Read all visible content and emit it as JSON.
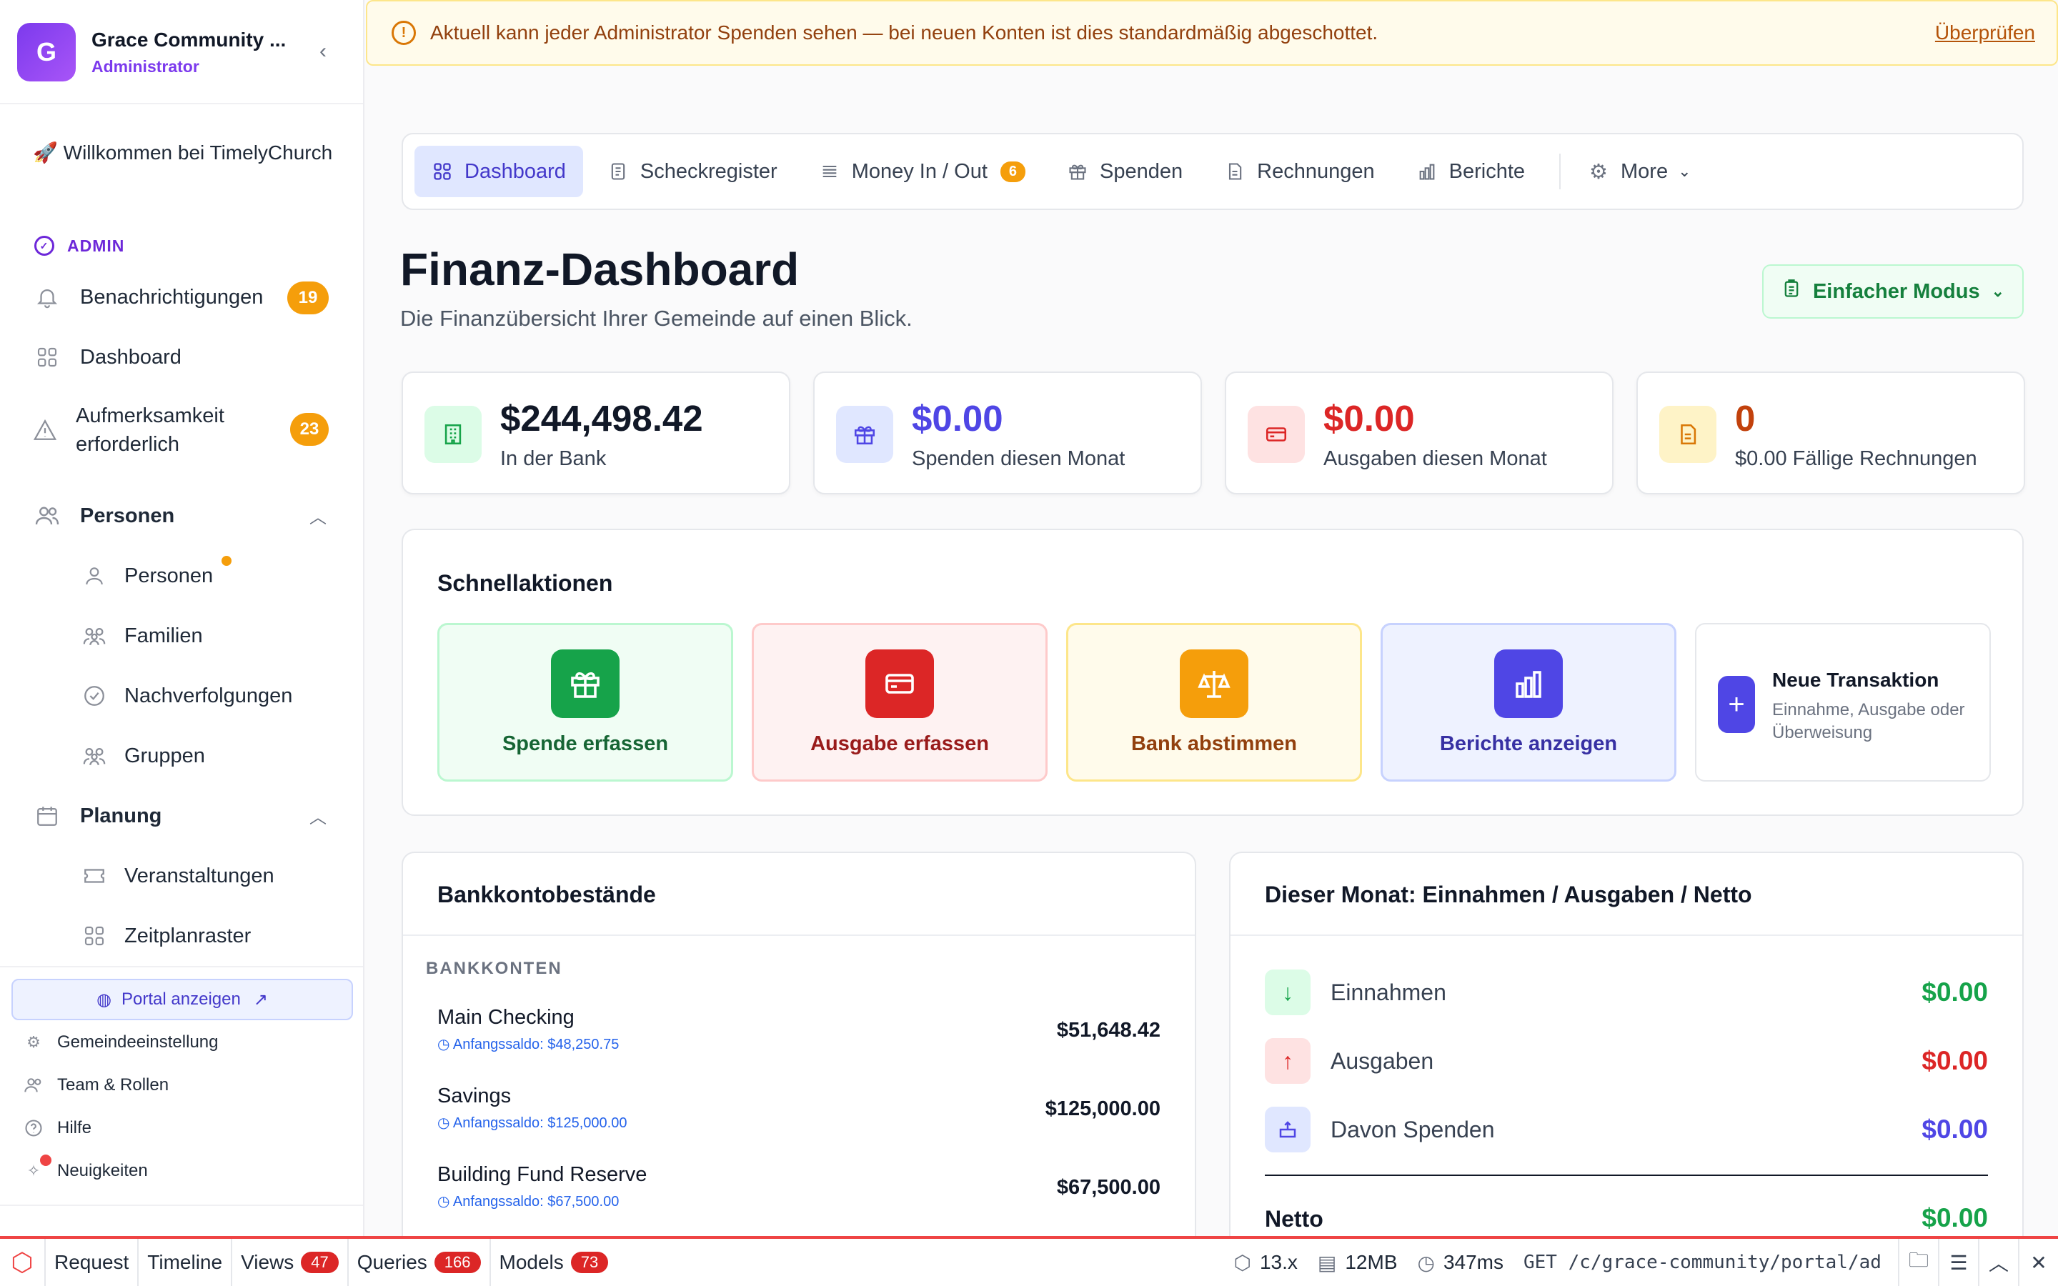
{
  "org": {
    "initial": "G",
    "name": "Grace Community ...",
    "role": "Administrator"
  },
  "sidebar": {
    "welcome": "🚀 Willkommen bei TimelyChurch",
    "admin_label": "ADMIN",
    "notifications": {
      "label": "Benachrichtigungen",
      "count": "19"
    },
    "dashboard": "Dashboard",
    "attention": {
      "label": "Aufmerksamkeit erforderlich",
      "count": "23"
    },
    "people_section": "Personen",
    "people_items": [
      "Personen",
      "Familien",
      "Nachverfolgungen",
      "Gruppen"
    ],
    "planning_section": "Planung",
    "planning_items": [
      "Veranstaltungen",
      "Zeitplanraster"
    ],
    "portal": "Portal anzeigen",
    "footer": [
      "Gemeindeeinstellung",
      "Team & Rollen",
      "Hilfe",
      "Neuigkeiten"
    ]
  },
  "alert": {
    "text": "Aktuell kann jeder Administrator Spenden sehen — bei neuen Konten ist dies standardmäßig abgeschottet.",
    "link": "Überprüfen"
  },
  "tabs": [
    {
      "label": "Dashboard",
      "icon": "grid-icon"
    },
    {
      "label": "Scheckregister",
      "icon": "receipt-icon"
    },
    {
      "label": "Money In / Out",
      "icon": "list-icon",
      "count": "6"
    },
    {
      "label": "Spenden",
      "icon": "gift-icon"
    },
    {
      "label": "Rechnungen",
      "icon": "document-icon"
    },
    {
      "label": "Berichte",
      "icon": "bar-chart-icon"
    },
    {
      "label": "More",
      "icon": "gear-icon"
    }
  ],
  "page": {
    "title": "Finanz-Dashboard",
    "subtitle": "Die Finanzübersicht Ihrer Gemeinde auf einen Blick.",
    "mode_button": "Einfacher Modus"
  },
  "stats": [
    {
      "value": "$244,498.42",
      "label": "In der Bank",
      "color": "#111827",
      "icon": "building-icon"
    },
    {
      "value": "$0.00",
      "label": "Spenden diesen Monat",
      "color": "#4f46e5",
      "icon": "gift-icon"
    },
    {
      "value": "$0.00",
      "label": "Ausgaben diesen Monat",
      "color": "#dc2626",
      "icon": "credit-card-icon"
    },
    {
      "value": "0",
      "label": "$0.00 Fällige Rechnungen",
      "color": "#c2410c",
      "icon": "document-icon"
    }
  ],
  "quick_actions": {
    "title": "Schnellaktionen",
    "items": [
      {
        "label": "Spende erfassen",
        "icon": "gift-icon"
      },
      {
        "label": "Ausgabe erfassen",
        "icon": "credit-card-icon"
      },
      {
        "label": "Bank abstimmen",
        "icon": "scale-icon"
      },
      {
        "label": "Berichte anzeigen",
        "icon": "bar-chart-icon"
      }
    ],
    "new_transaction": {
      "title": "Neue Transaktion",
      "description": "Einnahme, Ausgabe oder Überweisung"
    }
  },
  "bank": {
    "title": "Bankkontobestände",
    "section": "BANKKONTEN",
    "accounts": [
      {
        "name": "Main Checking",
        "opening": "Anfangssaldo: $48,250.75",
        "amount": "$51,648.42"
      },
      {
        "name": "Savings",
        "opening": "Anfangssaldo: $125,000.00",
        "amount": "$125,000.00"
      },
      {
        "name": "Building Fund Reserve",
        "opening": "Anfangssaldo: $67,500.00",
        "amount": "$67,500.00"
      }
    ]
  },
  "month": {
    "title": "Dieser Monat: Einnahmen / Ausgaben / Netto",
    "rows": [
      {
        "label": "Einnahmen",
        "value": "$0.00"
      },
      {
        "label": "Ausgaben",
        "value": "$0.00"
      },
      {
        "label": "Davon Spenden",
        "value": "$0.00"
      }
    ],
    "net_label": "Netto",
    "net_value": "$0.00"
  },
  "debugbar": {
    "items": [
      {
        "label": "Request"
      },
      {
        "label": "Timeline"
      },
      {
        "label": "Views",
        "count": "47"
      },
      {
        "label": "Queries",
        "count": "166"
      },
      {
        "label": "Models",
        "count": "73"
      }
    ],
    "version": "13.x",
    "memory": "12MB",
    "time": "347ms",
    "route": "GET /c/grace-community/portal/adm..."
  }
}
